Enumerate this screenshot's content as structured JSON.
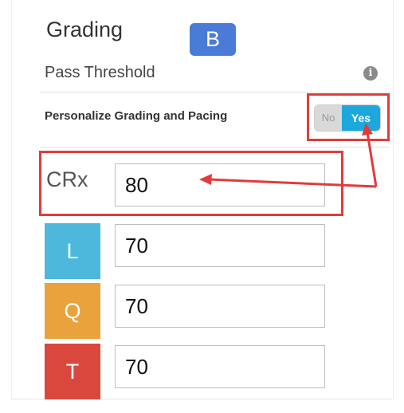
{
  "header": {
    "title": "Grading",
    "badge": "B"
  },
  "pass_threshold": {
    "label": "Pass Threshold",
    "info_icon": "info-icon"
  },
  "personalize": {
    "label": "Personalize Grading and Pacing",
    "toggle": {
      "off_label": "No",
      "on_label": "Yes",
      "value": "Yes"
    }
  },
  "rows": [
    {
      "label": "CRx",
      "value": "80",
      "color": ""
    },
    {
      "label": "L",
      "value": "70",
      "color": "#4db8dc"
    },
    {
      "label": "Q",
      "value": "70",
      "color": "#eaa23c"
    },
    {
      "label": "T",
      "value": "70",
      "color": "#d9473d"
    }
  ],
  "annotation": {
    "color": "#e23b3b"
  }
}
